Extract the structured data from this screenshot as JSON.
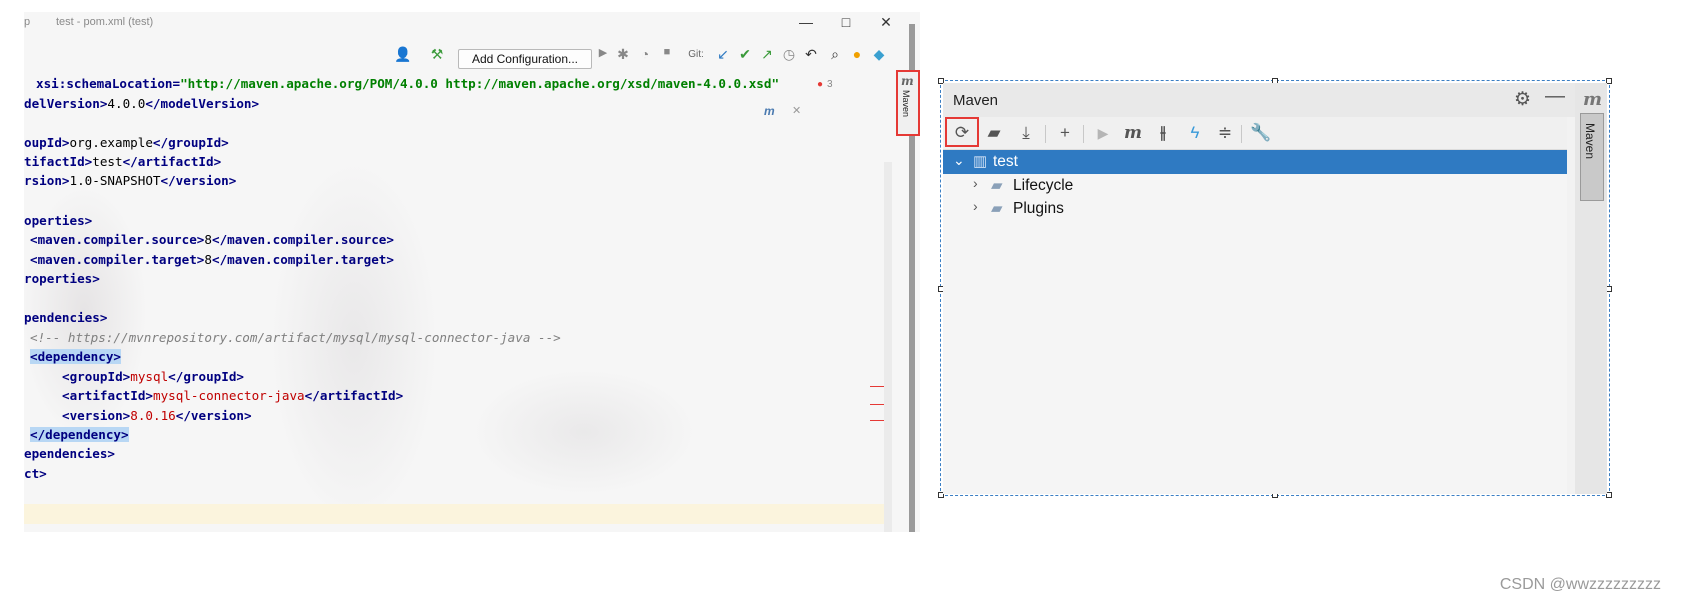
{
  "ide": {
    "title": "test - pom.xml (test)",
    "title_prefix": "p",
    "window_controls": [
      "—",
      "□",
      "✕"
    ],
    "add_configuration": "Add Configuration...",
    "git_label": "Git:",
    "side_tab_label": "Maven",
    "warning_count": "3",
    "code_lines": {
      "l1_a": "xsi:schemaLocation=",
      "l1_b": "\"http://maven.apache.org/POM/4.0.0 http://maven.apache.org/xsd/maven-4.0.0.xsd\"",
      "l2_a": "delVersion>",
      "l2_b": "4.0.0",
      "l2_c": "</modelVersion>",
      "l3_a": "oupId>",
      "l3_b": "org.example",
      "l3_c": "</groupId>",
      "l4_a": "tifactId>",
      "l4_b": "test",
      "l4_c": "</artifactId>",
      "l5_a": "rsion>",
      "l5_b": "1.0-SNAPSHOT",
      "l5_c": "</version>",
      "l6": "operties>",
      "l7_a": "<maven.compiler.source>",
      "l7_b": "8",
      "l7_c": "</maven.compiler.source>",
      "l8_a": "<maven.compiler.target>",
      "l8_b": "8",
      "l8_c": "</maven.compiler.target>",
      "l9": "roperties>",
      "l10": "pendencies>",
      "l11": "<!-- https://mvnrepository.com/artifact/mysql/mysql-connector-java -->",
      "l12": "<dependency>",
      "l13_a": "<groupId>",
      "l13_b": "mysql",
      "l13_c": "</groupId>",
      "l14_a": "<artifactId>",
      "l14_b": "mysql-connector-java",
      "l14_c": "</artifactId>",
      "l15_a": "<version>",
      "l15_b": "8.0.16",
      "l15_c": "</version>",
      "l16": "</dependency>",
      "l17": "ependencies>",
      "l18": "ct>"
    }
  },
  "maven": {
    "title": "Maven",
    "side_tab_label": "Maven",
    "tree": [
      {
        "label": "test",
        "expanded": true,
        "selected": true
      },
      {
        "label": "Lifecycle",
        "expanded": false
      },
      {
        "label": "Plugins",
        "expanded": false
      }
    ]
  },
  "watermark": "CSDN @wwzzzzzzzzz",
  "colors": {
    "selection": "#2f7ac2",
    "highlight_box": "#e53935",
    "xml_tag": "#000080",
    "xml_value": "#c00000"
  }
}
